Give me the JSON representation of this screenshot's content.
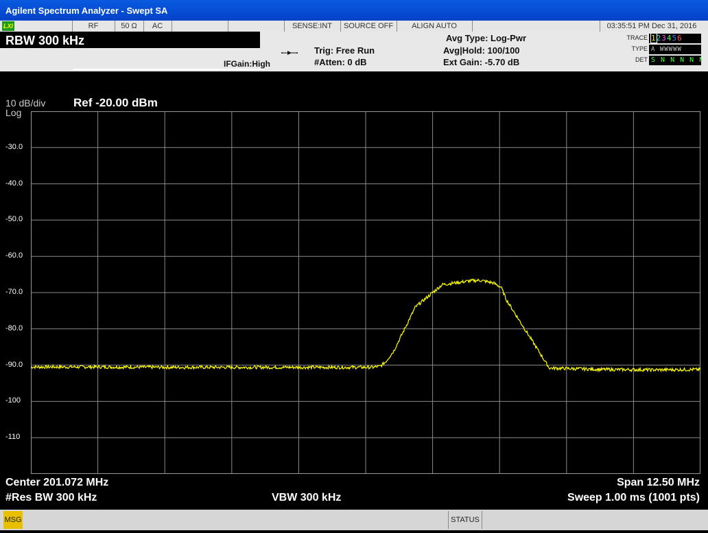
{
  "window": {
    "title": "Agilent Spectrum Analyzer - Swept SA"
  },
  "status_strip": {
    "lxi": "LXI",
    "rf": "RF",
    "impedance": "50 Ω",
    "coupling": "AC",
    "sense": "SENSE:INT",
    "source": "SOURCE OFF",
    "align": "ALIGN AUTO",
    "datetime": "03:35:51 PM Dec 31, 2016"
  },
  "header": {
    "rbw": "RBW 300 kHz",
    "ifgain": "IFGain:High",
    "trig": "Trig: Free Run",
    "atten": "#Atten: 0 dB",
    "avg_type": "Avg Type: Log-Pwr",
    "avg_hold": "Avg|Hold: 100/100",
    "ext_gain": "Ext Gain: -5.70 dB",
    "trace_label": "TRACE",
    "type_label": "TYPE",
    "det_label": "DET",
    "trace_numbers": [
      "1",
      "2",
      "3",
      "4",
      "5",
      "6"
    ],
    "trace_colors": [
      "#ffff00",
      "#00e0e0",
      "#ff40ff",
      "#40ff40",
      "#4080ff",
      "#ff6060"
    ],
    "type_value": "A WWWWW",
    "det_value": "S N N N N N"
  },
  "graph": {
    "scale": "10 dB/div",
    "mode": "Log",
    "ref": "Ref -20.00 dBm",
    "y_labels": [
      "-30.0",
      "-40.0",
      "-50.0",
      "-60.0",
      "-70.0",
      "-80.0",
      "-90.0",
      "-100",
      "-110"
    ]
  },
  "chart_data": {
    "type": "line",
    "x_unit": "MHz",
    "y_unit": "dBm",
    "xlim": [
      194.822,
      207.322
    ],
    "ylim": [
      -120,
      -20
    ],
    "grid": true,
    "series": [
      {
        "color": "#ffff00",
        "x": [
          194.822,
          196.0,
          197.5,
          199.0,
          200.5,
          201.2,
          201.35,
          201.45,
          201.6,
          202.0,
          202.5,
          203.0,
          203.2,
          203.45,
          203.6,
          203.7,
          204.5,
          205.5,
          206.5,
          207.322
        ],
        "y": [
          -90.5,
          -90.5,
          -90.6,
          -90.6,
          -90.6,
          -90.6,
          -90.3,
          -89.0,
          -86.0,
          -74.0,
          -67.8,
          -66.8,
          -66.6,
          -67.3,
          -68.5,
          -72.0,
          -90.8,
          -91.2,
          -91.3,
          -91.2
        ]
      }
    ]
  },
  "bottom": {
    "center": "Center 201.072 MHz",
    "span": "Span 12.50 MHz",
    "res_bw": "#Res BW 300 kHz",
    "vbw": "VBW 300 kHz",
    "sweep": "Sweep  1.00 ms (1001 pts)"
  },
  "statusbar": {
    "msg": "MSG",
    "status": "STATUS"
  }
}
